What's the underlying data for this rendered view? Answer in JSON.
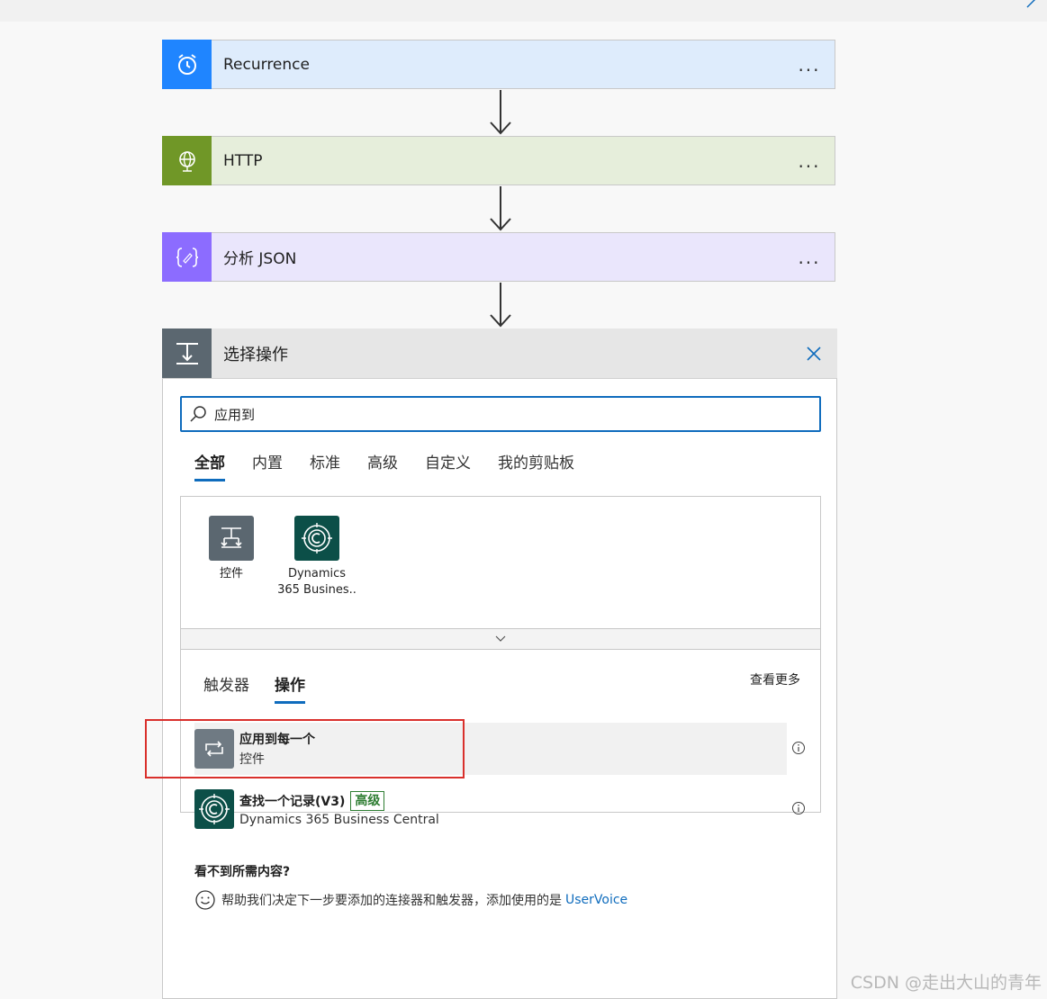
{
  "flow_steps": [
    {
      "title": "Recurrence",
      "color": "#1f85ff",
      "bg": "#deecfc",
      "icon": "alarm-clock-icon",
      "more": "..."
    },
    {
      "title": "HTTP",
      "color": "#709727",
      "bg": "#e6eedb",
      "icon": "globe-icon",
      "more": "..."
    },
    {
      "title": "分析 JSON",
      "color": "#8c6cff",
      "bg": "#eae6fc",
      "icon": "json-braces-icon",
      "more": "..."
    }
  ],
  "panel": {
    "title": "选择操作",
    "search_value": "应用到",
    "tabs": [
      "全部",
      "内置",
      "标准",
      "高级",
      "自定义",
      "我的剪贴板"
    ],
    "active_tab": "全部",
    "connectors": [
      {
        "label": "控件",
        "icon": "control-icon",
        "color": "#5b6770"
      },
      {
        "label": "Dynamics 365 Busines..",
        "icon": "dynamics-365-icon",
        "color": "#0c4f48"
      }
    ],
    "subtabs": [
      "触发器",
      "操作"
    ],
    "active_subtab": "操作",
    "see_more": "查看更多",
    "actions": [
      {
        "name": "应用到每一个",
        "subtitle": "控件",
        "icon": "loop-icon",
        "color": "#6f7a83",
        "highlighted": true
      },
      {
        "name": "查找一个记录(V3)",
        "badge": "高级",
        "subtitle": "Dynamics 365 Business Central",
        "icon": "dynamics-365-icon",
        "color": "#0c4f48"
      }
    ],
    "missing_title": "看不到所需内容?",
    "feedback_text": "帮助我们决定下一步要添加的连接器和触发器，添加使用的是",
    "feedback_link": "UserVoice"
  },
  "watermark": "CSDN @走出大山的青年",
  "colors": {
    "accent": "#0f6cbd",
    "highlight_box": "#d9302c",
    "premium_badge": "#2e7d32"
  }
}
